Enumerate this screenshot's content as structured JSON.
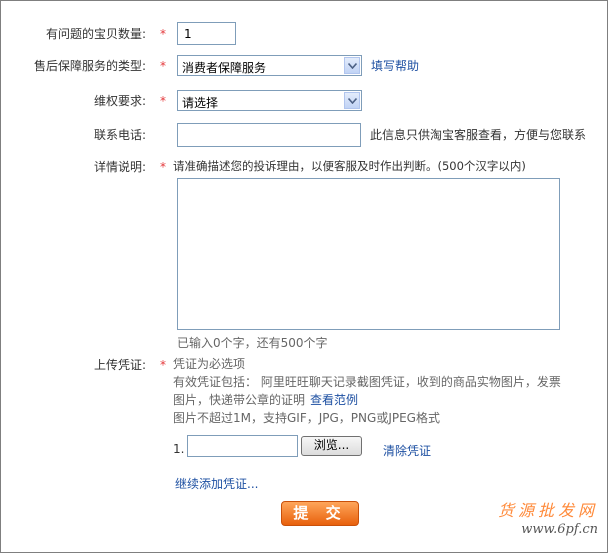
{
  "form": {
    "quantity": {
      "label": "有问题的宝贝数量:",
      "required": "*",
      "value": "1"
    },
    "service_type": {
      "label": "售后保障服务的类型:",
      "required": "*",
      "selected": "消费者保障服务",
      "help_link": "填写帮助"
    },
    "rights": {
      "label": "维权要求:",
      "required": "*",
      "selected": "请选择"
    },
    "phone": {
      "label": "联系电话:",
      "value": "",
      "note": "此信息只供淘宝客服查看，方便与您联系"
    },
    "details": {
      "label": "详情说明:",
      "required": "*",
      "instruction": "请准确描述您的投诉理由，以便客服及时作出判断。(500个汉字以内)",
      "value": "",
      "counter": "已输入0个字，还有500个字"
    },
    "upload": {
      "label": "上传凭证:",
      "required": "*",
      "required_note": "凭证为必选项",
      "valid_line1": "有效凭证包括： 阿里旺旺聊天记录截图凭证，收到的商品实物图片，发票",
      "valid_line2": "图片，快递带公章的证明",
      "example_link": "查看范例",
      "limits": "图片不超过1M，支持GIF，JPG，PNG或JPEG格式",
      "file_index": "1.",
      "file_value": "",
      "browse_label": "浏览...",
      "clear_link": "清除凭证",
      "add_more_link": "继续添加凭证..."
    },
    "submit_label": "提 交"
  },
  "watermark": {
    "line1": "货源批发网",
    "line2": "www.6pf.cn"
  },
  "colors": {
    "accent_red": "#e4393c",
    "link_blue": "#1e50a2",
    "submit_orange": "#f07a28"
  }
}
